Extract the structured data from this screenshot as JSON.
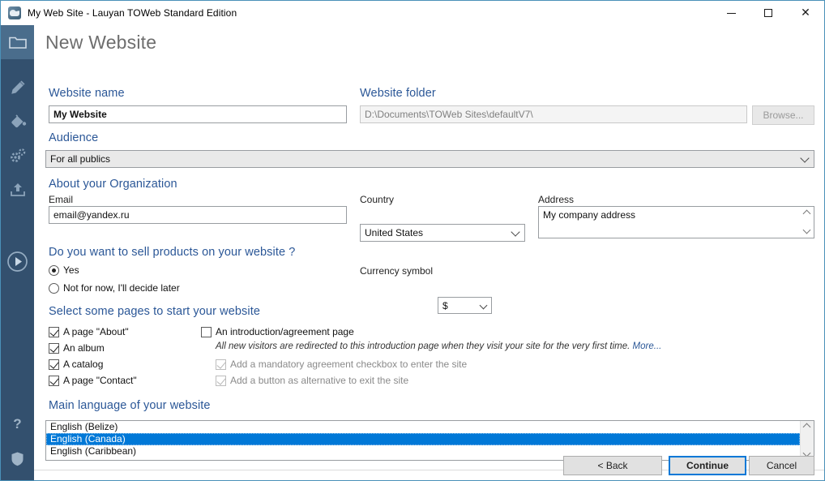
{
  "window": {
    "title": "My Web Site - Lauyan TOWeb Standard Edition",
    "app_icon": "towerb-app-icon",
    "controls": {
      "minimize": "minimize",
      "maximize": "maximize",
      "close": "close"
    }
  },
  "rail": {
    "items": [
      {
        "name": "site",
        "icon": "folder-icon",
        "active": true
      },
      {
        "name": "edit",
        "icon": "pencil-icon",
        "active": false
      },
      {
        "name": "theme",
        "icon": "paint-bucket-icon",
        "active": false
      },
      {
        "name": "settings",
        "icon": "gears-icon",
        "active": false
      },
      {
        "name": "publish",
        "icon": "upload-icon",
        "active": false
      },
      {
        "name": "preview",
        "icon": "play-circle-icon",
        "active": false
      }
    ],
    "bottom_items": [
      {
        "name": "help",
        "icon": "question-mark-icon"
      },
      {
        "name": "security",
        "icon": "shield-icon"
      }
    ]
  },
  "page": {
    "title": "New Website"
  },
  "website_name": {
    "label": "Website name",
    "value": "My Website",
    "placeholder": ""
  },
  "website_folder": {
    "label": "Website folder",
    "value": "D:\\Documents\\TOWeb Sites\\defaultV7\\",
    "browse_label": "Browse..."
  },
  "audience": {
    "label": "Audience",
    "value": "For all publics",
    "options": [
      "For all publics"
    ]
  },
  "organization": {
    "heading": "About your Organization",
    "email": {
      "label": "Email",
      "value": "email@yandex.ru"
    },
    "country": {
      "label": "Country",
      "value": "United States",
      "options": [
        "United States"
      ]
    },
    "address": {
      "label": "Address",
      "value": "My company address"
    }
  },
  "sell": {
    "question": "Do you want to sell products on your website ?",
    "options": [
      {
        "label": "Yes",
        "selected": true
      },
      {
        "label": "Not for now, I'll decide later",
        "selected": false
      }
    ],
    "currency": {
      "label": "Currency symbol",
      "value": "$",
      "options": [
        "$"
      ]
    }
  },
  "pages": {
    "heading": "Select some pages to start your website",
    "left": [
      {
        "label": "A page \"About\"",
        "checked": true
      },
      {
        "label": "An album",
        "checked": true
      },
      {
        "label": "A catalog",
        "checked": true
      },
      {
        "label": "A page \"Contact\"",
        "checked": true
      }
    ],
    "intro": {
      "label": "An introduction/agreement page",
      "checked": false
    },
    "intro_hint": "All new visitors are redirected to this introduction page when they visit your site for the very first time.",
    "intro_hint_link": "More...",
    "sub": [
      {
        "label": "Add a mandatory agreement checkbox to enter the site",
        "checked": true,
        "disabled": true
      },
      {
        "label": "Add a button as alternative to exit the site",
        "checked": true,
        "disabled": true
      }
    ]
  },
  "language": {
    "heading": "Main language of your website",
    "items": [
      {
        "label": "English (Belize)",
        "selected": false
      },
      {
        "label": "English (Canada)",
        "selected": true
      },
      {
        "label": "English (Caribbean)",
        "selected": false
      }
    ]
  },
  "footer": {
    "back": "< Back",
    "continue": "Continue",
    "cancel": "Cancel"
  },
  "colors": {
    "accent_heading": "#2b5797",
    "rail_bg": "#33506e",
    "rail_active": "#4a6d8c",
    "selection": "#0078d7",
    "window_border": "#4a90b8"
  }
}
